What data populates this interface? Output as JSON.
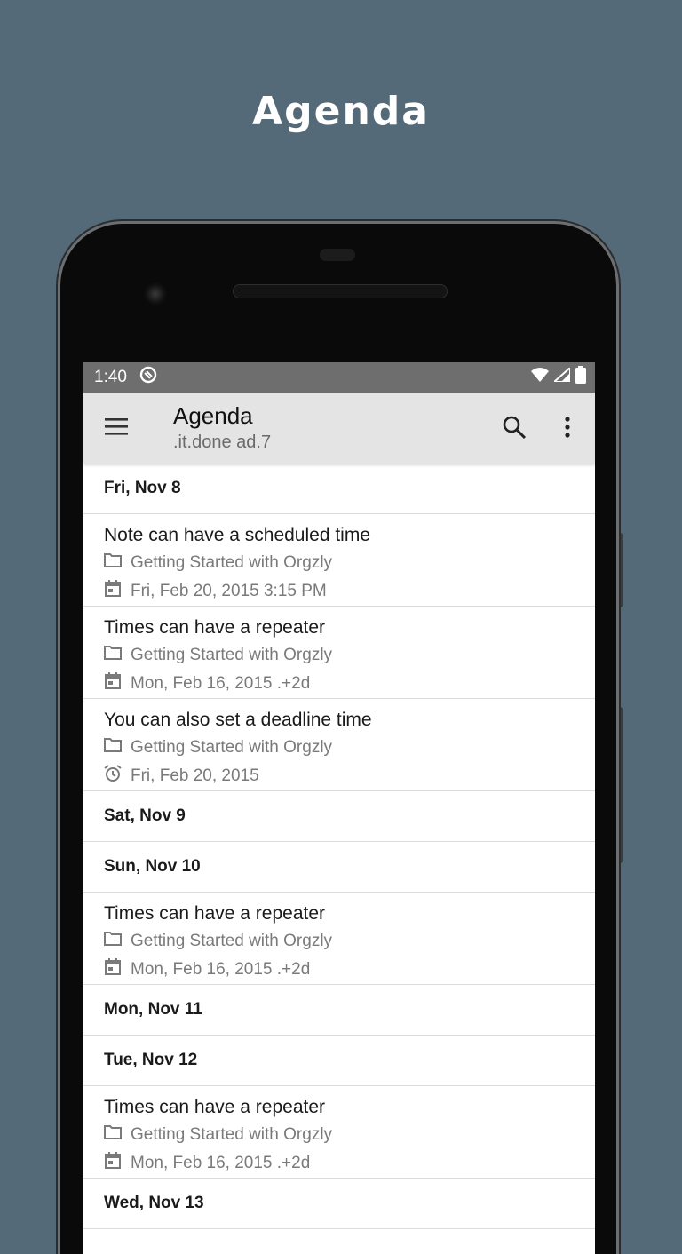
{
  "promo": {
    "title": "Agenda"
  },
  "status_bar": {
    "time": "1:40"
  },
  "toolbar": {
    "title": "Agenda",
    "subtitle": ".it.done ad.7"
  },
  "agenda": {
    "days": [
      {
        "label": "Fri, Nov 8",
        "notes": [
          {
            "title": "Note can have a scheduled time",
            "book": "Getting Started with Orgzly",
            "time_icon": "calendar-icon",
            "time": "Fri, Feb 20, 2015 3:15 PM"
          },
          {
            "title": "Times can have a repeater",
            "book": "Getting Started with Orgzly",
            "time_icon": "calendar-icon",
            "time": "Mon, Feb 16, 2015 .+2d"
          },
          {
            "title": "You can also set a deadline time",
            "book": "Getting Started with Orgzly",
            "time_icon": "alarm-icon",
            "time": "Fri, Feb 20, 2015"
          }
        ]
      },
      {
        "label": "Sat, Nov 9",
        "notes": []
      },
      {
        "label": "Sun, Nov 10",
        "notes": [
          {
            "title": "Times can have a repeater",
            "book": "Getting Started with Orgzly",
            "time_icon": "calendar-icon",
            "time": "Mon, Feb 16, 2015 .+2d"
          }
        ]
      },
      {
        "label": "Mon, Nov 11",
        "notes": []
      },
      {
        "label": "Tue, Nov 12",
        "notes": [
          {
            "title": "Times can have a repeater",
            "book": "Getting Started with Orgzly",
            "time_icon": "calendar-icon",
            "time": "Mon, Feb 16, 2015 .+2d"
          }
        ]
      },
      {
        "label": "Wed, Nov 13",
        "notes": []
      }
    ]
  },
  "colors": {
    "background": "#546a78",
    "status_bar": "#6e6e6e",
    "toolbar": "#e4e4e4"
  }
}
